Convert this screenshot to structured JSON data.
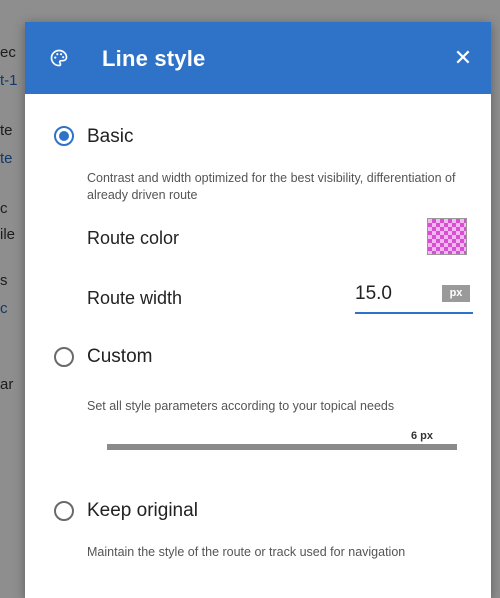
{
  "background": {
    "fragments": [
      "ec",
      "t-1",
      "te",
      "te",
      "c",
      "ile",
      "s",
      "c",
      "ar"
    ]
  },
  "dialog": {
    "title": "Line style",
    "header_icon": "palette-icon",
    "close_icon": "close-icon",
    "accent_color": "#2f73c8",
    "options": {
      "basic": {
        "label": "Basic",
        "selected": true,
        "description": "Contrast and width optimized for the best visibility, differentiation of already driven route",
        "route_color_label": "Route color",
        "route_color_swatch": "#e070e0",
        "route_width_label": "Route width",
        "route_width_value": "15.0",
        "route_width_unit": "px"
      },
      "custom": {
        "label": "Custom",
        "selected": false,
        "description": "Set all style parameters according to your topical needs",
        "slider_value_label": "6 px"
      },
      "keep_original": {
        "label": "Keep original",
        "selected": false,
        "description": "Maintain the style of the route or track used for navigation"
      }
    }
  }
}
